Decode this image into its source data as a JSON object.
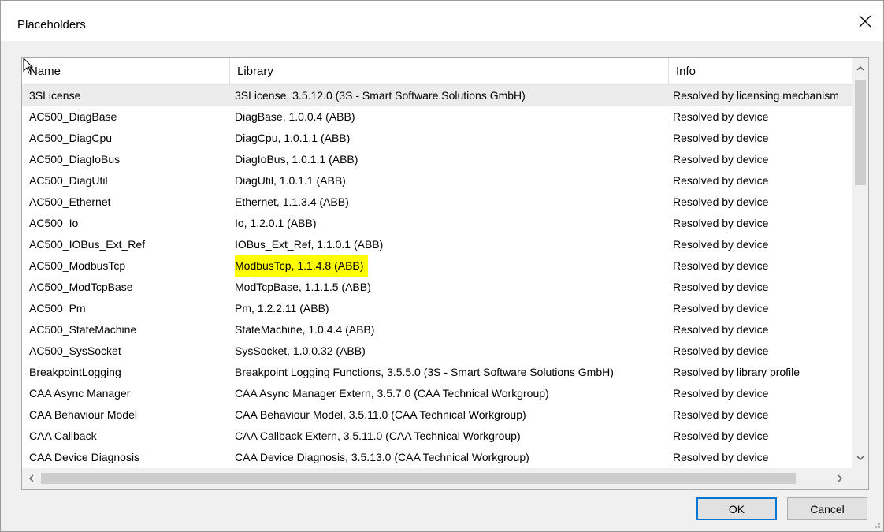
{
  "window": {
    "title": "Placeholders"
  },
  "columns": {
    "name": "Name",
    "library": "Library",
    "info": "Info"
  },
  "rows": [
    {
      "name": "3SLicense",
      "library": "3SLicense, 3.5.12.0 (3S - Smart Software Solutions GmbH)",
      "info": "Resolved by licensing mechanism"
    },
    {
      "name": "AC500_DiagBase",
      "library": "DiagBase, 1.0.0.4 (ABB)",
      "info": "Resolved by device"
    },
    {
      "name": "AC500_DiagCpu",
      "library": "DiagCpu, 1.0.1.1 (ABB)",
      "info": "Resolved by device"
    },
    {
      "name": "AC500_DiagIoBus",
      "library": "DiagIoBus, 1.0.1.1 (ABB)",
      "info": "Resolved by device"
    },
    {
      "name": "AC500_DiagUtil",
      "library": "DiagUtil, 1.0.1.1 (ABB)",
      "info": "Resolved by device"
    },
    {
      "name": "AC500_Ethernet",
      "library": "Ethernet, 1.1.3.4 (ABB)",
      "info": "Resolved by device"
    },
    {
      "name": "AC500_Io",
      "library": "Io, 1.2.0.1 (ABB)",
      "info": "Resolved by device"
    },
    {
      "name": "AC500_IOBus_Ext_Ref",
      "library": "IOBus_Ext_Ref, 1.1.0.1 (ABB)",
      "info": "Resolved by device"
    },
    {
      "name": "AC500_ModbusTcp",
      "library": "ModbusTcp, 1.1.4.8 (ABB)",
      "info": "Resolved by device"
    },
    {
      "name": "AC500_ModTcpBase",
      "library": "ModTcpBase, 1.1.1.5 (ABB)",
      "info": "Resolved by device"
    },
    {
      "name": "AC500_Pm",
      "library": "Pm, 1.2.2.11 (ABB)",
      "info": "Resolved by device"
    },
    {
      "name": "AC500_StateMachine",
      "library": "StateMachine, 1.0.4.4 (ABB)",
      "info": "Resolved by device"
    },
    {
      "name": "AC500_SysSocket",
      "library": "SysSocket, 1.0.0.32 (ABB)",
      "info": "Resolved by device"
    },
    {
      "name": "BreakpointLogging",
      "library": "Breakpoint Logging Functions, 3.5.5.0 (3S - Smart Software Solutions GmbH)",
      "info": "Resolved by library profile"
    },
    {
      "name": "CAA Async Manager",
      "library": "CAA Async Manager Extern, 3.5.7.0 (CAA Technical Workgroup)",
      "info": "Resolved by device"
    },
    {
      "name": "CAA Behaviour Model",
      "library": "CAA Behaviour Model, 3.5.11.0 (CAA Technical Workgroup)",
      "info": "Resolved by device"
    },
    {
      "name": "CAA Callback",
      "library": "CAA Callback Extern, 3.5.11.0 (CAA Technical Workgroup)",
      "info": "Resolved by device"
    },
    {
      "name": "CAA Device Diagnosis",
      "library": "CAA Device Diagnosis, 3.5.13.0 (CAA Technical Workgroup)",
      "info": "Resolved by device"
    }
  ],
  "selected_row": 0,
  "highlighted_row": 8,
  "highlight_color": "#ffff00",
  "buttons": {
    "ok": "OK",
    "cancel": "Cancel"
  },
  "icons": {
    "close": "close-icon",
    "scroll_up": "chevron-up-icon",
    "scroll_down": "chevron-down-icon",
    "scroll_left": "chevron-left-icon",
    "scroll_right": "chevron-right-icon"
  }
}
